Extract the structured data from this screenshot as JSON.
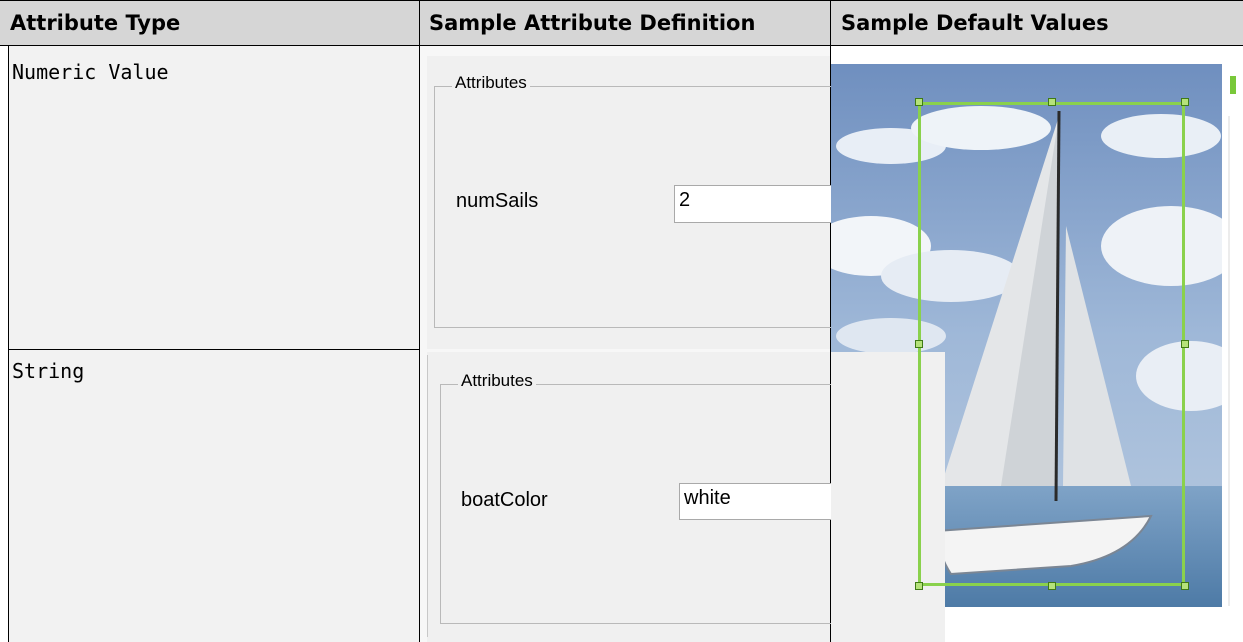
{
  "table": {
    "headers": [
      "Attribute Type",
      "Sample Attribute Definition",
      "Sample Default Values"
    ],
    "rows": [
      {
        "type": "Numeric Value",
        "definition": {
          "group_title": "Attributes",
          "field_label": "numSails",
          "field_value": "2"
        }
      },
      {
        "type": "String",
        "definition": {
          "group_title": "Attributes",
          "field_label": "boatColor",
          "field_value": "white"
        }
      }
    ]
  },
  "colors": {
    "header_bg": "#d6d6d6",
    "cell_bg": "#f2f2f2",
    "bbox_green": "#8ad14c"
  },
  "image": {
    "subject": "sailboat photo with bounding box",
    "icon": "sailboat-image"
  }
}
